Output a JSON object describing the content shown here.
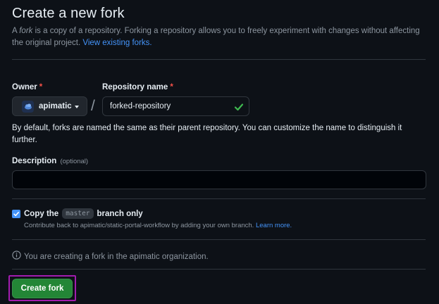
{
  "page": {
    "title": "Create a new fork",
    "intro_word": "fork",
    "intro_prefix": "A ",
    "intro_rest": " is a copy of a repository. Forking a repository allows you to freely experiment with changes without affecting the original project. ",
    "view_forks_link": "View existing forks."
  },
  "owner": {
    "label": "Owner",
    "required_mark": "*",
    "selected": "apimatic"
  },
  "repository": {
    "label": "Repository name",
    "required_mark": "*",
    "value": "forked-repository",
    "valid": true
  },
  "slash": "/",
  "helper_text": "By default, forks are named the same as their parent repository. You can customize the name to distinguish it further.",
  "description": {
    "label": "Description",
    "optional_label": "(optional)",
    "value": ""
  },
  "copy_branch": {
    "checked": true,
    "label_prefix": "Copy the",
    "branch": "master",
    "label_suffix": "branch only",
    "sub_text": "Contribute back to apimatic/static-portal-workflow by adding your own branch. ",
    "learn_more": "Learn more."
  },
  "info": {
    "icon": "info-icon",
    "text": "You are creating a fork in the apimatic organization."
  },
  "create_button": {
    "label": "Create fork"
  },
  "colors": {
    "background": "#0d1117",
    "primary_button": "#238636",
    "link": "#4493f8",
    "required": "#f85149",
    "valid_check": "#3fb950",
    "focus_outline": "#a21caf"
  }
}
